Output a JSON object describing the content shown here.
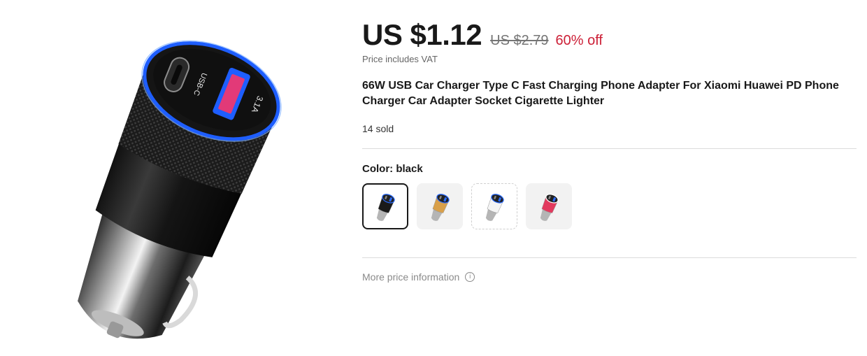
{
  "product": {
    "price_current": "US $1.12",
    "price_original": "US $2.79",
    "discount": "60% off",
    "vat_note": "Price includes VAT",
    "title": "66W USB Car Charger Type C Fast Charging Phone Adapter For Xiaomi Huawei PD Phone Charger Car Adapter Socket Cigarette Lighter",
    "sold": "14 sold"
  },
  "image": {
    "port_c_label": "USB-C",
    "port_a_label": "3.1A"
  },
  "color": {
    "label": "Color: black",
    "swatches": [
      {
        "name": "black",
        "body": "#1a1a1a",
        "ring": "#2a6bff"
      },
      {
        "name": "gold",
        "body": "#d9a04a",
        "ring": "#2a6bff"
      },
      {
        "name": "white",
        "body": "#f4f4f4",
        "ring": "#2a6bff"
      },
      {
        "name": "pink",
        "body": "#e23a5e",
        "ring": "#ffffff"
      }
    ]
  },
  "more_info": {
    "label": "More price information",
    "icon": "info-icon"
  },
  "colors": {
    "discount": "#cc1f36",
    "text": "#191919",
    "muted": "#757575",
    "led_ring": "#1e5eff"
  }
}
